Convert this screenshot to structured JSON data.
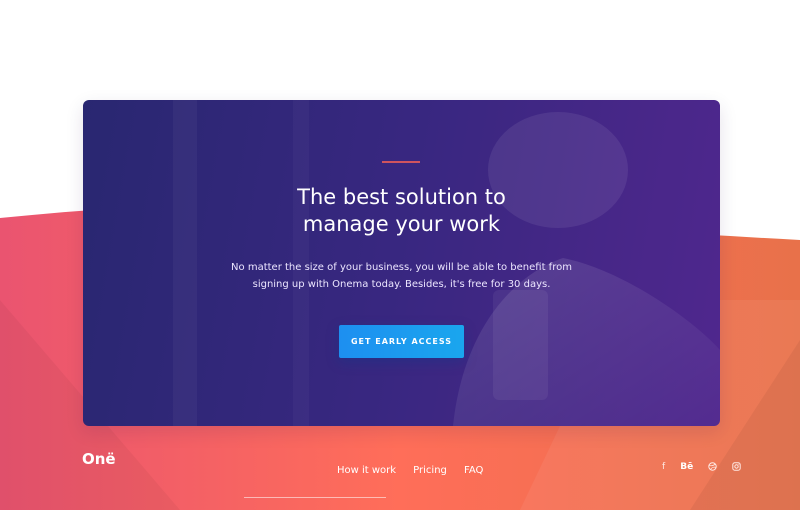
{
  "cta": {
    "headline_line1": "The best solution to",
    "headline_line2": "manage your work",
    "subtext_line1": "No matter the size of your business, you will be able to benefit from",
    "subtext_line2": "signing up with Onema today. Besides, it's free for 30 days.",
    "button_label": "GET EARLY ACCESS"
  },
  "footer": {
    "logo": "Onë",
    "nav": [
      "How it work",
      "Pricing",
      "FAQ"
    ],
    "social": {
      "facebook": "f",
      "behance": "Bē",
      "dribbble": "dribbble-icon",
      "instagram": "instagram-icon"
    }
  },
  "colors": {
    "card_start": "#2c2a78",
    "card_end": "#552a96",
    "accent_line": "#e05a5a",
    "button": "#1d8ff0",
    "wave_left": "#ea5470",
    "wave_mid": "#ff6e59",
    "wave_right": "#e8714a"
  }
}
